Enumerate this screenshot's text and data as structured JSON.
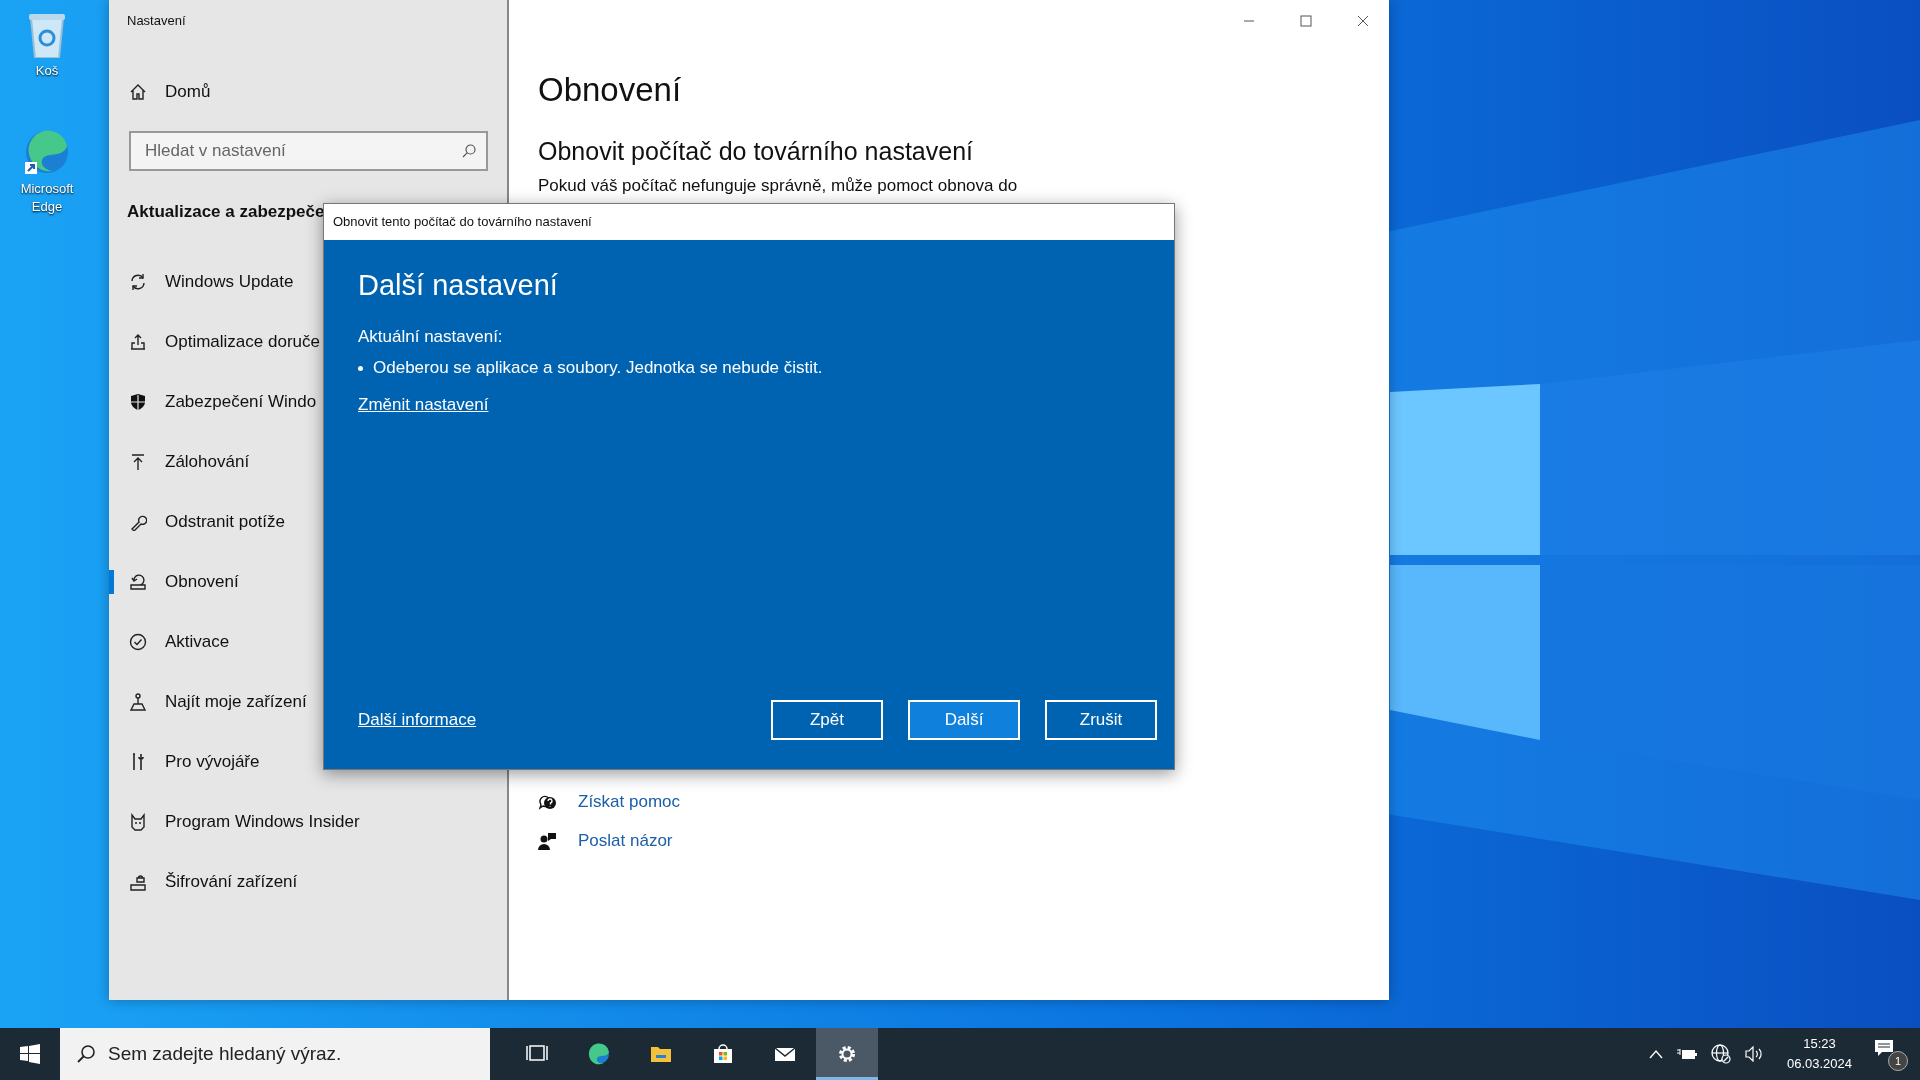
{
  "desktop_icons": [
    {
      "label": "Koš"
    },
    {
      "label": "Microsoft Edge"
    }
  ],
  "settings_window": {
    "title": "Nastavení",
    "sidebar": {
      "home": "Domů",
      "search": {
        "placeholder": "Hledat v nastavení"
      },
      "section_title": "Aktualizace a zabezpeče",
      "items": [
        {
          "label": "Windows Update",
          "selected": false
        },
        {
          "label": "Optimalizace doruče",
          "selected": false
        },
        {
          "label": "Zabezpečení Windo",
          "selected": false
        },
        {
          "label": "Zálohování",
          "selected": false
        },
        {
          "label": "Odstranit potíže",
          "selected": false
        },
        {
          "label": "Obnovení",
          "selected": true
        },
        {
          "label": "Aktivace",
          "selected": false
        },
        {
          "label": "Najít moje zařízení",
          "selected": false
        },
        {
          "label": "Pro vývojáře",
          "selected": false
        },
        {
          "label": "Program Windows Insider",
          "selected": false
        },
        {
          "label": "Šifrování zařízení",
          "selected": false
        }
      ]
    },
    "content": {
      "heading": "Obnovení",
      "subheading": "Obnovit počítač do továrního nastavení",
      "paragraph": "Pokud váš počítač nefunguje správně, může pomoct obnova do",
      "help_links": [
        {
          "label": "Získat pomoc"
        },
        {
          "label": "Poslat názor"
        }
      ]
    }
  },
  "dialog": {
    "title": "Obnovit tento počítač do továrního nastavení",
    "heading": "Další nastavení",
    "current_label": "Aktuální nastavení:",
    "bullets": [
      "Odeberou se aplikace a soubory. Jednotka se nebude čistit."
    ],
    "change_link": "Změnit nastavení",
    "more_info_link": "Další informace",
    "buttons": [
      {
        "label": "Zpět",
        "default": false
      },
      {
        "label": "Další",
        "default": true
      },
      {
        "label": "Zrušit",
        "default": false
      }
    ]
  },
  "taskbar": {
    "search": {
      "placeholder": "Sem zadejte hledaný výraz."
    },
    "apps": [
      {
        "selected": false
      },
      {
        "selected": false
      },
      {
        "selected": false
      },
      {
        "selected": false
      },
      {
        "selected": false
      },
      {
        "selected": true
      }
    ],
    "time": "15:23",
    "date": "06.03.2024",
    "notification_count": "1"
  }
}
